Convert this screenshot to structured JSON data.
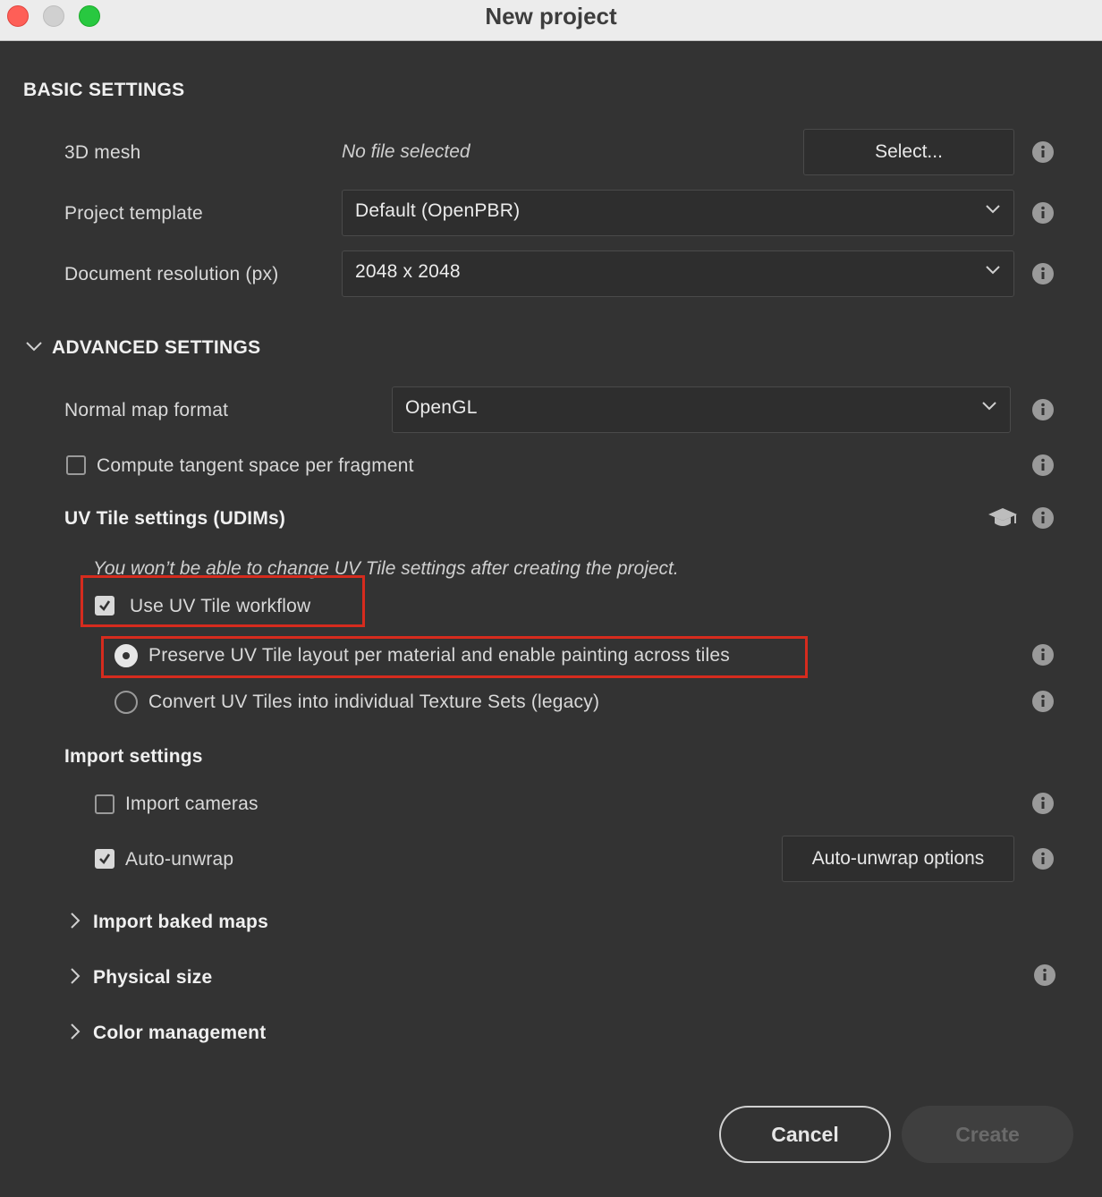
{
  "window": {
    "title": "New project"
  },
  "basic": {
    "heading": "BASIC SETTINGS",
    "mesh_label": "3D mesh",
    "mesh_value": "No file selected",
    "select_button": "Select...",
    "template_label": "Project template",
    "template_value": "Default (OpenPBR)",
    "resolution_label": "Document resolution (px)",
    "resolution_value": "2048 x 2048"
  },
  "advanced": {
    "heading": "ADVANCED SETTINGS",
    "normal_label": "Normal map format",
    "normal_value": "OpenGL",
    "tangent_label": "Compute tangent space per fragment",
    "tangent_checked": false,
    "uv_heading": "UV Tile settings (UDIMs)",
    "uv_note": "You won’t be able to change UV Tile settings after creating the project.",
    "uv_workflow_label": "Use UV Tile workflow",
    "uv_workflow_checked": true,
    "radio_preserve": "Preserve UV Tile layout per material and enable painting across tiles",
    "radio_convert": "Convert UV Tiles into individual Texture Sets (legacy)",
    "selected_radio": "preserve"
  },
  "import": {
    "heading": "Import settings",
    "cameras_label": "Import cameras",
    "cameras_checked": false,
    "unwrap_label": "Auto-unwrap",
    "unwrap_checked": true,
    "unwrap_options_button": "Auto-unwrap options"
  },
  "collapsibles": {
    "baked": "Import baked maps",
    "physical": "Physical size",
    "color": "Color management"
  },
  "footer": {
    "cancel": "Cancel",
    "create": "Create"
  },
  "colors": {
    "highlight": "#d62b1e",
    "background": "#333333"
  }
}
